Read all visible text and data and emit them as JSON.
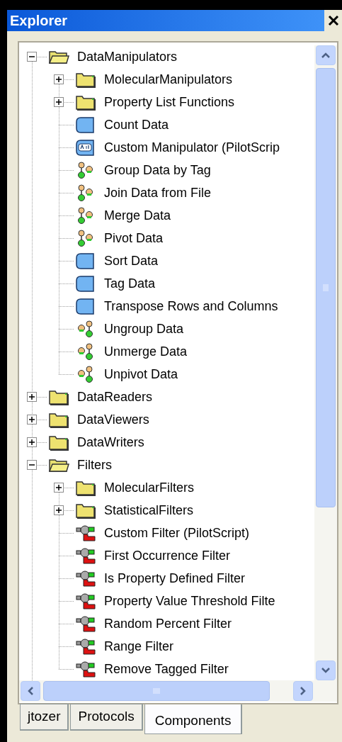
{
  "window": {
    "title": "Explorer"
  },
  "tree": [
    {
      "label": "DataManipulators",
      "kind": "folder",
      "expanded": true,
      "children": [
        {
          "label": "MolecularManipulators",
          "kind": "folder",
          "expanded": false
        },
        {
          "label": "Property List Functions",
          "kind": "folder",
          "expanded": false
        },
        {
          "label": "Count Data",
          "kind": "data"
        },
        {
          "label": "Custom Manipulator (PilotScrip",
          "kind": "script"
        },
        {
          "label": "Group Data by Tag",
          "kind": "join"
        },
        {
          "label": "Join Data from File",
          "kind": "join"
        },
        {
          "label": "Merge Data",
          "kind": "join"
        },
        {
          "label": "Pivot Data",
          "kind": "join"
        },
        {
          "label": "Sort Data",
          "kind": "data"
        },
        {
          "label": "Tag Data",
          "kind": "data"
        },
        {
          "label": "Transpose Rows and Columns",
          "kind": "data"
        },
        {
          "label": "Ungroup Data",
          "kind": "split"
        },
        {
          "label": "Unmerge Data",
          "kind": "split"
        },
        {
          "label": "Unpivot Data",
          "kind": "split"
        }
      ]
    },
    {
      "label": "DataReaders",
      "kind": "folder",
      "expanded": false
    },
    {
      "label": "DataViewers",
      "kind": "folder",
      "expanded": false
    },
    {
      "label": "DataWriters",
      "kind": "folder",
      "expanded": false
    },
    {
      "label": "Filters",
      "kind": "folder",
      "expanded": true,
      "children": [
        {
          "label": "MolecularFilters",
          "kind": "folder",
          "expanded": false
        },
        {
          "label": "StatisticalFilters",
          "kind": "folder",
          "expanded": false
        },
        {
          "label": "Custom Filter (PilotScript)",
          "kind": "filter"
        },
        {
          "label": "First Occurrence Filter",
          "kind": "filter"
        },
        {
          "label": "Is Property Defined Filter",
          "kind": "filter"
        },
        {
          "label": "Property Value Threshold Filte",
          "kind": "filter"
        },
        {
          "label": "Random Percent Filter",
          "kind": "filter"
        },
        {
          "label": "Range Filter",
          "kind": "filter"
        },
        {
          "label": "Remove Tagged Filter",
          "kind": "filter"
        }
      ]
    }
  ],
  "tabs": [
    {
      "label": "jtozer",
      "selected": false
    },
    {
      "label": "Protocols",
      "selected": false
    },
    {
      "label": "Components",
      "selected": true
    }
  ]
}
